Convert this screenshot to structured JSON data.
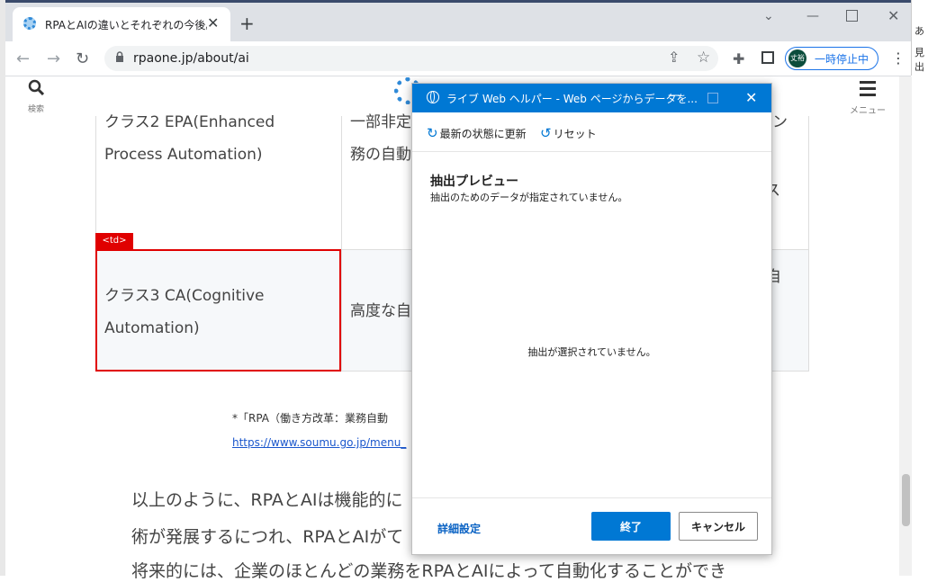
{
  "browser": {
    "tab_title": "RPAとAIの違いとそれぞれの今後。比",
    "url": "rpaone.jp/about/ai",
    "profile_initials": "丈裕",
    "profile_label": "一時停止中",
    "bg_right_texts": [
      "あ",
      "見出"
    ]
  },
  "site": {
    "search_label": "検索",
    "menu_label": "メニュー"
  },
  "table": {
    "row1_col1_lines": [
      "クラス2 EPA(Enhanced",
      "Process Automation)"
    ],
    "row1_col2_lines": [
      "一部非定",
      "務の自動"
    ],
    "row1_col3_partial": [
      "ン",
      "ス"
    ],
    "row2_col1_lines": [
      "クラス3 CA(Cognitive",
      "Automation)"
    ],
    "row2_col2": "高度な自",
    "row2_col3_partial": "自",
    "selected_tag": "<td>"
  },
  "footnote": {
    "text": "*「RPA（働き方改革：業務自動",
    "link": "https://www.soumu.go.jp/menu_"
  },
  "body_lines": [
    "以上のように、RPAとAIは機能的に",
    "術が発展するにつれ、RPAとAIがて",
    "将来的には、企業のほとんどの業務をRPAとAIによって自動化することができ"
  ],
  "dialog": {
    "title": "ライブ Web ヘルパー - Web ページからデータを...",
    "refresh_label": "最新の状態に更新",
    "reset_label": "リセット",
    "heading": "抽出プレビュー",
    "subheading": "抽出のためのデータが指定されていません。",
    "empty_message": "抽出が選択されていません。",
    "advanced_label": "詳細設定",
    "ok_label": "終了",
    "cancel_label": "キャンセル"
  },
  "colors": {
    "accent": "#0078d4",
    "selection": "#e00000",
    "link": "#1a56cc"
  }
}
